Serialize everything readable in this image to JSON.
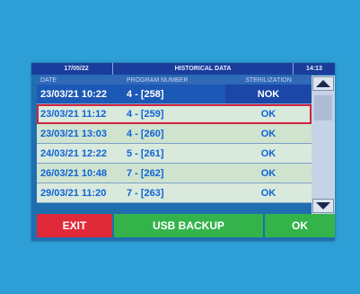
{
  "topbar": {
    "date": "17/05/22",
    "title": "HISTORICAL DATA",
    "time": "14:13"
  },
  "columns": {
    "date": "DATE",
    "program": "PROGRAM NUMBER",
    "sterilization": "STERILIZATION"
  },
  "rows": [
    {
      "date": "23/03/21 10:22",
      "program": "4 -  [258]",
      "sterilization": "NOK"
    },
    {
      "date": "23/03/21 11:12",
      "program": "4 -  [259]",
      "sterilization": "OK"
    },
    {
      "date": "23/03/21 13:03",
      "program": "4 -  [260]",
      "sterilization": "OK"
    },
    {
      "date": "24/03/21 12:22",
      "program": "5 -  [261]",
      "sterilization": "OK"
    },
    {
      "date": "26/03/21 10:48",
      "program": "7 -  [262]",
      "sterilization": "OK"
    },
    {
      "date": "29/03/21 11:20",
      "program": "7 -  [263]",
      "sterilization": "OK"
    }
  ],
  "buttons": {
    "exit": "EXIT",
    "usb_backup": "USB BACKUP",
    "ok": "OK"
  },
  "colors": {
    "selection_outline": "#d0233a",
    "exit": "#e02a3a",
    "ok": "#34b34a"
  }
}
